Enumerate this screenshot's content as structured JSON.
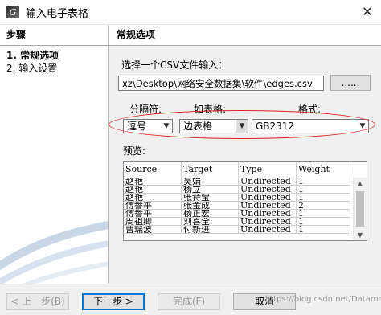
{
  "window": {
    "title": "输入电子表格",
    "close_glyph": "✕"
  },
  "steps": {
    "header": "步骤",
    "items": [
      {
        "label": "1. 常规选项"
      },
      {
        "label": "2. 输入设置"
      }
    ]
  },
  "main": {
    "section_title": "常规选项",
    "file_prompt": "选择一个CSV文件输入：",
    "file_path": "xz\\Desktop\\网络安全数据集\\软件\\edges.csv",
    "browse_label": "......",
    "separator_label": "分隔符:",
    "table_label": "如表格:",
    "format_label": "格式:",
    "separator_value": "逗号",
    "table_value": "边表格",
    "format_value": "GB2312",
    "preview_label": "预览:"
  },
  "preview_table": {
    "columns": [
      "Source",
      "Target",
      "Type",
      "Weight"
    ],
    "rows": [
      [
        "赵艳",
        "吴娟",
        "Undirected",
        "1"
      ],
      [
        "赵艳",
        "杨立",
        "Undirected",
        "1"
      ],
      [
        "赵艳",
        "张诗莹",
        "Undirected",
        "1"
      ],
      [
        "傅譽平",
        "张金成",
        "Undirected",
        "2"
      ],
      [
        "傅譽平",
        "杨正宏",
        "Undirected",
        "1"
      ],
      [
        "周祖卿",
        "刘喜全",
        "Undirected",
        "1"
      ],
      [
        "曹瑞波",
        "付新进",
        "Undirected",
        "1"
      ]
    ]
  },
  "footer": {
    "back_label": "< 上一步(B)",
    "next_label": "下一步 >",
    "finish_label": "完成(F)",
    "cancel_label": "取消",
    "watermark": "https://blog.csdn.net/Datamount"
  },
  "colors": {
    "highlight": "#e02020",
    "focus_border": "#0078d7"
  }
}
